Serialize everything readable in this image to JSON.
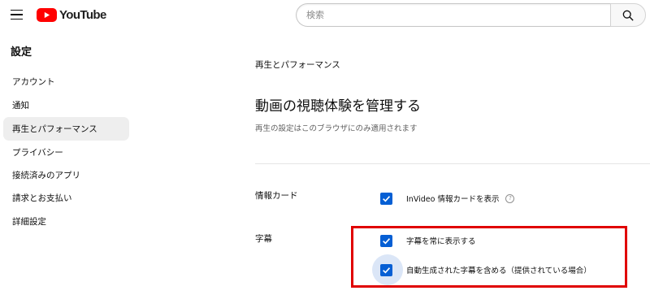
{
  "header": {
    "logo_text": "YouTube",
    "search": {
      "placeholder": "検索",
      "value": ""
    }
  },
  "sidebar": {
    "title": "設定",
    "items": [
      {
        "label": "アカウント",
        "active": false
      },
      {
        "label": "通知",
        "active": false
      },
      {
        "label": "再生とパフォーマンス",
        "active": true
      },
      {
        "label": "プライバシー",
        "active": false
      },
      {
        "label": "接続済みのアプリ",
        "active": false
      },
      {
        "label": "請求とお支払い",
        "active": false
      },
      {
        "label": "詳細設定",
        "active": false
      }
    ]
  },
  "main": {
    "breadcrumb": "再生とパフォーマンス",
    "heading": "動画の視聴体験を管理する",
    "subheading": "再生の設定はこのブラウザにのみ適用されます",
    "sections": [
      {
        "label": "情報カード",
        "options": [
          {
            "label": "InVideo 情報カードを表示",
            "checked": true,
            "help_icon": true
          }
        ]
      },
      {
        "label": "字幕",
        "options": [
          {
            "label": "字幕を常に表示する",
            "checked": true
          },
          {
            "label": "自動生成された字幕を含める（提供されている場合）",
            "checked": true
          }
        ]
      }
    ]
  },
  "colors": {
    "brand_red": "#ff0000",
    "checkbox_blue": "#065fd4",
    "active_item_bg": "#eeeeee",
    "annotation_red": "#e00000"
  }
}
